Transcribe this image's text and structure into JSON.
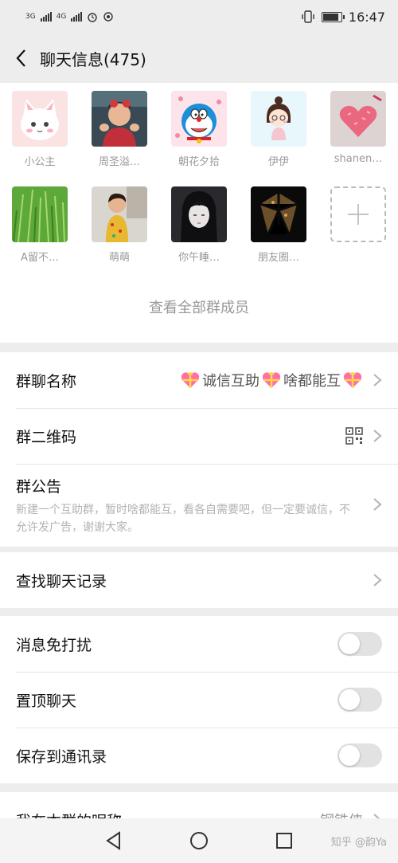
{
  "status_bar": {
    "net1": "3G",
    "net2": "4G",
    "time": "16:47",
    "battery_level": 0.85
  },
  "header": {
    "title": "聊天信息(475)"
  },
  "members": [
    {
      "name": "小公主",
      "icon": "cat-avatar"
    },
    {
      "name": "周圣溢…",
      "icon": "child-photo-avatar"
    },
    {
      "name": "朝花夕拾",
      "icon": "doraemon-avatar"
    },
    {
      "name": "伊伊",
      "icon": "cartoon-girl-avatar"
    },
    {
      "name": "shanen…",
      "icon": "pink-heart-avatar"
    },
    {
      "name": "A留不…",
      "icon": "grass-avatar"
    },
    {
      "name": "萌萌",
      "icon": "child-photo-avatar"
    },
    {
      "name": "你午睡…",
      "icon": "anime-girl-avatar"
    },
    {
      "name": "朋友圈…",
      "icon": "dark-logo-avatar"
    }
  ],
  "view_all": "查看全部群成员",
  "settings": {
    "group_name_label": "群聊名称",
    "group_name_parts": [
      "诚信互助",
      "啥都能互"
    ],
    "qrcode_label": "群二维码",
    "notice_label": "群公告",
    "notice_text": "新建一个互助群，暂时啥都能互，看各自需要吧，但一定要诚信，不允许发广告，谢谢大家。",
    "search_history_label": "查找聊天记录",
    "mute_label": "消息免打扰",
    "mute_on": false,
    "pin_label": "置顶聊天",
    "pin_on": false,
    "save_contacts_label": "保存到通讯录",
    "save_contacts_on": false,
    "nickname_label": "我在本群的昵称",
    "nickname_value": "钢铁侠"
  },
  "watermark": "知乎 @韵Ya",
  "colors": {
    "page_bg": "#ededed",
    "heart": "#ff5c9a"
  }
}
